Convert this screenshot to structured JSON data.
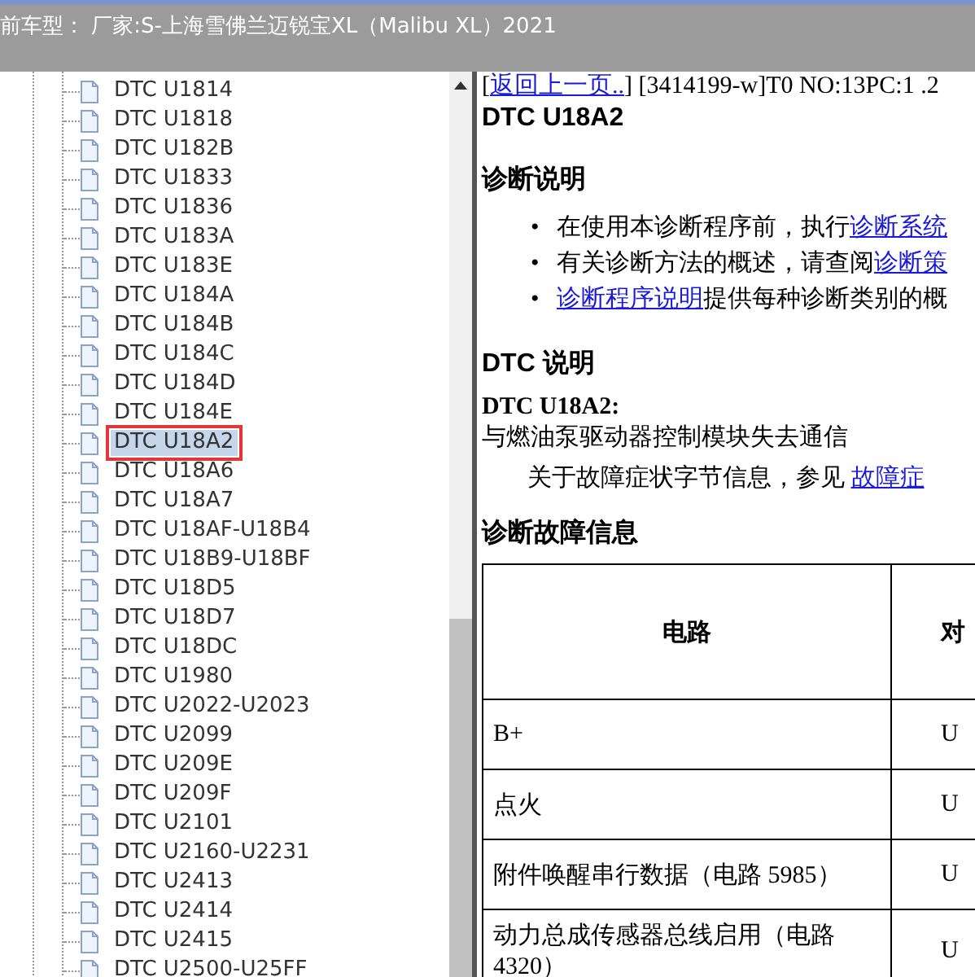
{
  "header": {
    "title": "前车型：  厂家:S-上海雪佛兰迈锐宝XL（Malibu XL）2021"
  },
  "tree": {
    "items": [
      {
        "label": "DTC U1814",
        "selected": false
      },
      {
        "label": "DTC U1818",
        "selected": false
      },
      {
        "label": "DTC U182B",
        "selected": false
      },
      {
        "label": "DTC U1833",
        "selected": false
      },
      {
        "label": "DTC U1836",
        "selected": false
      },
      {
        "label": "DTC U183A",
        "selected": false
      },
      {
        "label": "DTC U183E",
        "selected": false
      },
      {
        "label": "DTC U184A",
        "selected": false
      },
      {
        "label": "DTC U184B",
        "selected": false
      },
      {
        "label": "DTC U184C",
        "selected": false
      },
      {
        "label": "DTC U184D",
        "selected": false
      },
      {
        "label": "DTC U184E",
        "selected": false
      },
      {
        "label": "DTC U18A2",
        "selected": true
      },
      {
        "label": "DTC U18A6",
        "selected": false
      },
      {
        "label": "DTC U18A7",
        "selected": false
      },
      {
        "label": "DTC U18AF-U18B4",
        "selected": false
      },
      {
        "label": "DTC U18B9-U18BF",
        "selected": false
      },
      {
        "label": "DTC U18D5",
        "selected": false
      },
      {
        "label": "DTC U18D7",
        "selected": false
      },
      {
        "label": "DTC U18DC",
        "selected": false
      },
      {
        "label": "DTC U1980",
        "selected": false
      },
      {
        "label": "DTC U2022-U2023",
        "selected": false
      },
      {
        "label": "DTC U2099",
        "selected": false
      },
      {
        "label": "DTC U209E",
        "selected": false
      },
      {
        "label": "DTC U209F",
        "selected": false
      },
      {
        "label": "DTC U2101",
        "selected": false
      },
      {
        "label": "DTC U2160-U2231",
        "selected": false
      },
      {
        "label": "DTC U2413",
        "selected": false
      },
      {
        "label": "DTC U2414",
        "selected": false
      },
      {
        "label": "DTC U2415",
        "selected": false
      },
      {
        "label": "DTC U2500-U25FF",
        "selected": false
      }
    ]
  },
  "content": {
    "nav": {
      "open": "[",
      "link": "返回上一页..",
      "rest": "] [3414199-w]T0 NO:13PC:1 .2"
    },
    "title": "DTC U18A2",
    "section_1": "诊断说明",
    "bullets": [
      {
        "marker": "•",
        "parts": [
          {
            "kind": "text",
            "text": "在使用本诊断程序前，执行"
          },
          {
            "kind": "link",
            "text": "诊断系统"
          }
        ]
      },
      {
        "marker": "•",
        "parts": [
          {
            "kind": "text",
            "text": "有关诊断方法的概述，请查阅"
          },
          {
            "kind": "link",
            "text": "诊断策"
          }
        ]
      },
      {
        "marker": "•",
        "parts": [
          {
            "kind": "link",
            "text": "诊断程序说明"
          },
          {
            "kind": "text",
            "text": "提供每种诊断类别的概"
          }
        ]
      }
    ],
    "section_2": "DTC 说明",
    "dtc_code": "DTC U18A2:",
    "dtc_desc": "与燃油泵驱动器控制模块失去通信",
    "note": [
      {
        "kind": "text",
        "text": "关于故障症状字节信息，参见 "
      },
      {
        "kind": "link",
        "text": "故障症"
      }
    ],
    "section_3": "诊断故障信息",
    "table": {
      "columns": [
        "电路",
        "对"
      ],
      "rows": [
        [
          "B+",
          "U"
        ],
        [
          "点火",
          "U"
        ],
        [
          "附件唤醒串行数据（电路 5985）",
          "U"
        ],
        [
          "动力总成传感器总线启用（电路 4320）",
          "U"
        ]
      ]
    }
  }
}
